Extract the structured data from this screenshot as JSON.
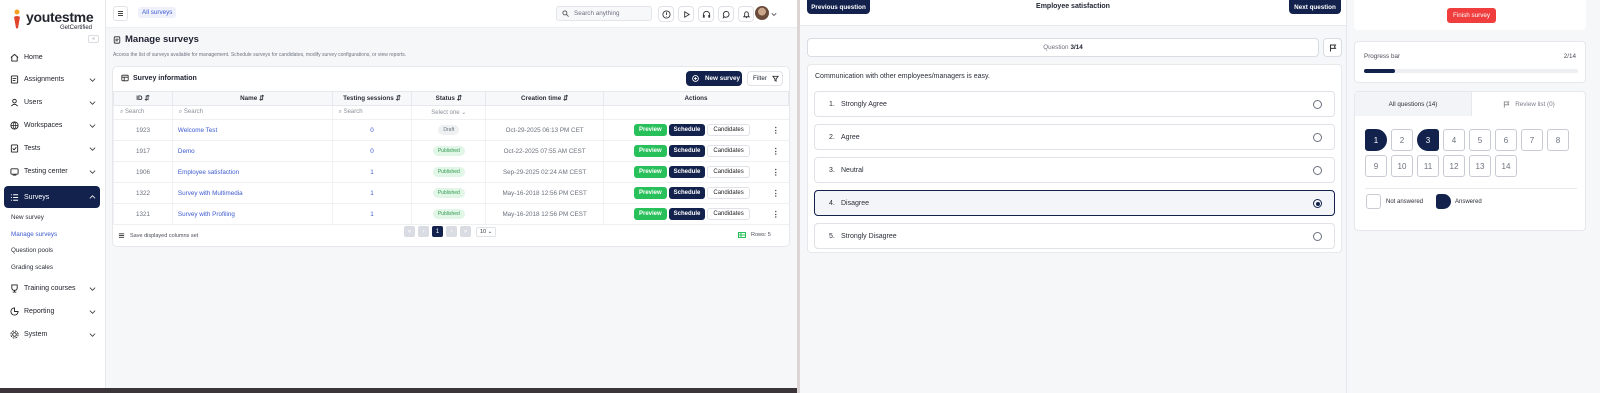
{
  "left_app": {
    "logo": {
      "text": "youtestme",
      "sub": "GetCertified"
    },
    "collapse": "«",
    "nav": [
      {
        "label": "Home",
        "icon": "home-icon"
      },
      {
        "label": "Assignments",
        "icon": "assignments-icon"
      },
      {
        "label": "Users",
        "icon": "users-icon"
      },
      {
        "label": "Workspaces",
        "icon": "workspaces-icon"
      },
      {
        "label": "Tests",
        "icon": "tests-icon"
      },
      {
        "label": "Testing center",
        "icon": "testing-center-icon"
      },
      {
        "label": "Surveys",
        "icon": "surveys-icon"
      },
      {
        "label": "Training courses",
        "icon": "training-icon"
      },
      {
        "label": "Reporting",
        "icon": "reporting-icon"
      },
      {
        "label": "System",
        "icon": "system-icon"
      }
    ],
    "surveys_sub": [
      "New survey",
      "Manage surveys",
      "Question pools",
      "Grading scales"
    ],
    "topbar": {
      "breadcrumb": "All surveys",
      "search_placeholder": "Search anything"
    },
    "page": {
      "title": "Manage surveys",
      "description": "Access the list of surveys available for management. Schedule surveys for candidates, modify survey configurations, or view reports."
    },
    "card": {
      "title": "Survey information",
      "new_button": "New survey",
      "filter_button": "Filter"
    },
    "table": {
      "headers": [
        "ID",
        "Name",
        "Testing sessions",
        "Status",
        "Creation time",
        "Actions"
      ],
      "filter_placeholders": {
        "id": "Search",
        "name": "Search",
        "sessions": "Search",
        "status": "Select one"
      },
      "rows": [
        {
          "id": "1923",
          "name": "Welcome Test",
          "sessions": "0",
          "status": "Draft",
          "created": "Oct-29-2025 06:13 PM CET"
        },
        {
          "id": "1917",
          "name": "Demo",
          "sessions": "0",
          "status": "Published",
          "created": "Oct-22-2025 07:55 AM CEST"
        },
        {
          "id": "1906",
          "name": "Employee satisfaction",
          "sessions": "1",
          "status": "Published",
          "created": "Sep-29-2025 02:24 AM CEST"
        },
        {
          "id": "1322",
          "name": "Survey with Multimedia",
          "sessions": "1",
          "status": "Published",
          "created": "May-16-2018 12:56 PM CEST"
        },
        {
          "id": "1321",
          "name": "Survey with Profiling",
          "sessions": "1",
          "status": "Published",
          "created": "May-16-2018 12:56 PM CEST"
        }
      ],
      "actions": {
        "preview": "Preview",
        "schedule": "Schedule",
        "candidates": "Candidates",
        "more": "⋮"
      }
    },
    "footer": {
      "save_columns": "Save displayed columns set",
      "current_page": "1",
      "page_size": "10",
      "rows": "Rows: 5"
    }
  },
  "survey_app": {
    "prev_button": "Previous question",
    "next_button": "Next question",
    "title": "Employee satisfaction",
    "counter_prefix": "Question",
    "counter_value": "3/14",
    "question": "Communication with other employees/managers is easy.",
    "options": [
      {
        "num": "1.",
        "label": "Strongly Agree",
        "selected": false
      },
      {
        "num": "2.",
        "label": "Agree",
        "selected": false
      },
      {
        "num": "3.",
        "label": "Neutral",
        "selected": false
      },
      {
        "num": "4.",
        "label": "Disagree",
        "selected": true
      },
      {
        "num": "5.",
        "label": "Strongly Disagree",
        "selected": false
      }
    ],
    "finish_button": "Finish survey",
    "progress": {
      "label": "Progress bar",
      "count": "2/14",
      "fraction": 0.143
    },
    "tabs": {
      "all": "All questions (14)",
      "review": "Review list (0)"
    },
    "questions": [
      {
        "n": "1",
        "state": "answered"
      },
      {
        "n": "2",
        "state": "none"
      },
      {
        "n": "3",
        "state": "current"
      },
      {
        "n": "4",
        "state": "none"
      },
      {
        "n": "5",
        "state": "none"
      },
      {
        "n": "6",
        "state": "none"
      },
      {
        "n": "7",
        "state": "none"
      },
      {
        "n": "8",
        "state": "none"
      },
      {
        "n": "9",
        "state": "none"
      },
      {
        "n": "10",
        "state": "none"
      },
      {
        "n": "11",
        "state": "none"
      },
      {
        "n": "12",
        "state": "none"
      },
      {
        "n": "13",
        "state": "none"
      },
      {
        "n": "14",
        "state": "none"
      }
    ],
    "legend": {
      "not_answered": "Not answered",
      "answered": "Answered"
    }
  },
  "colors": {
    "brand_navy": "#13224d",
    "green": "#28c05a",
    "red": "#f03e3e",
    "link": "#3c5bd0"
  }
}
